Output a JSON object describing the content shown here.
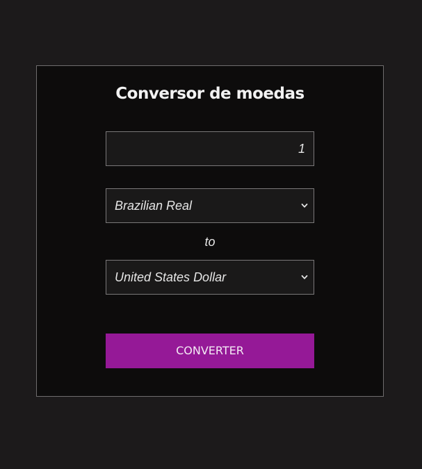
{
  "converter": {
    "title": "Conversor de moedas",
    "amount_value": "1",
    "from_currency": "Brazilian Real",
    "to_label": "to",
    "to_currency": "United States Dollar",
    "convert_label": "CONVERTER"
  },
  "colors": {
    "page_background": "#1c1a1b",
    "card_background": "#0d0c0c",
    "field_background": "#1a1919",
    "accent": "#951997"
  },
  "icons": {
    "select_arrow": "chevron-down-icon"
  }
}
